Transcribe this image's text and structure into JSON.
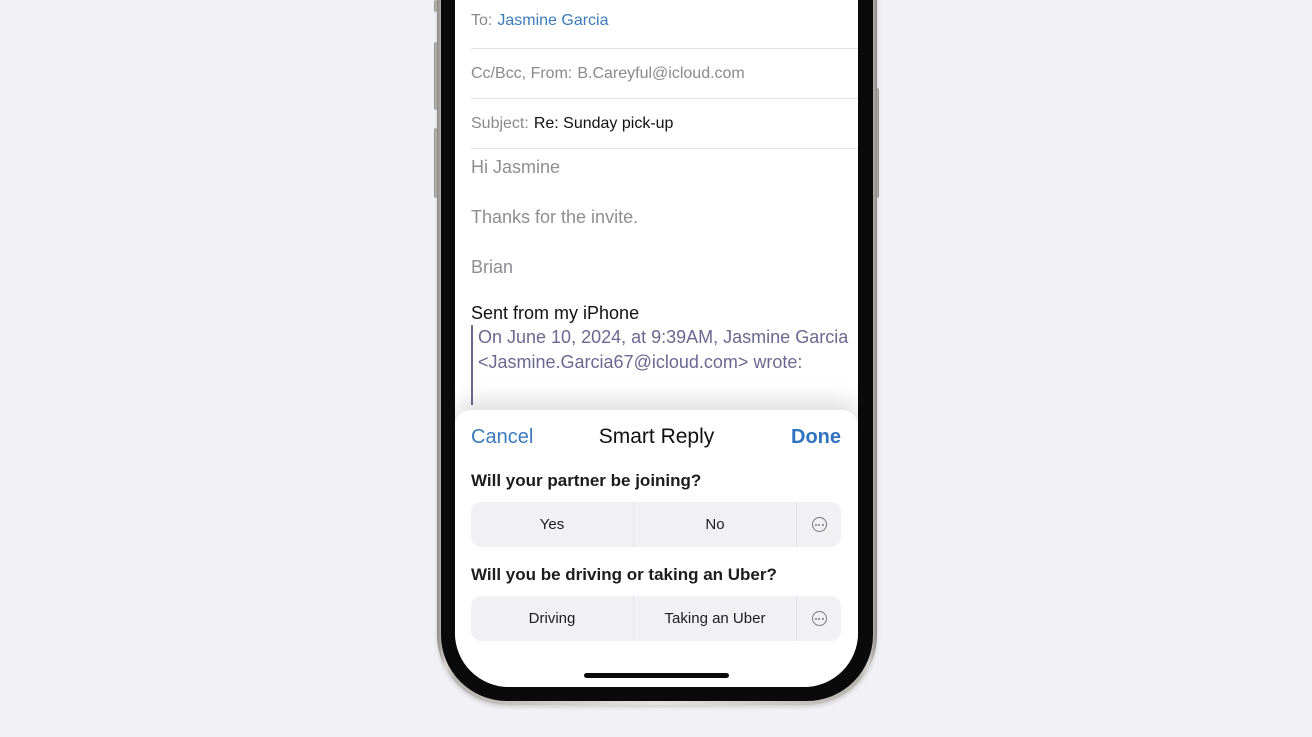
{
  "compose": {
    "to_label": "To:",
    "to_value": "Jasmine Garcia",
    "ccbcc_label": "Cc/Bcc, From:",
    "from_value": "B.Careyful@icloud.com",
    "subject_label": "Subject:",
    "subject_value": "Re: Sunday pick-up",
    "body": {
      "greeting": "Hi Jasmine",
      "line1": "Thanks for the invite.",
      "signature": "Brian"
    },
    "sent_from": "Sent from my iPhone",
    "quote": {
      "line1": "On June 10, 2024, at 9:39AM, Jasmine Garcia",
      "line2": "<Jasmine.Garcia67@icloud.com> wrote:"
    }
  },
  "smart_reply": {
    "cancel_label": "Cancel",
    "title": "Smart Reply",
    "done_label": "Done",
    "questions": [
      {
        "text": "Will your partner be joining?",
        "options": [
          "Yes",
          "No"
        ],
        "more_icon": "ellipsis-circle-icon"
      },
      {
        "text": "Will you be driving or taking an Uber?",
        "options": [
          "Driving",
          "Taking an Uber"
        ],
        "more_icon": "ellipsis-circle-icon"
      }
    ]
  },
  "colors": {
    "accent": "#3b7bbd",
    "quote": "#6a6891",
    "background": "#f2f2f6"
  }
}
